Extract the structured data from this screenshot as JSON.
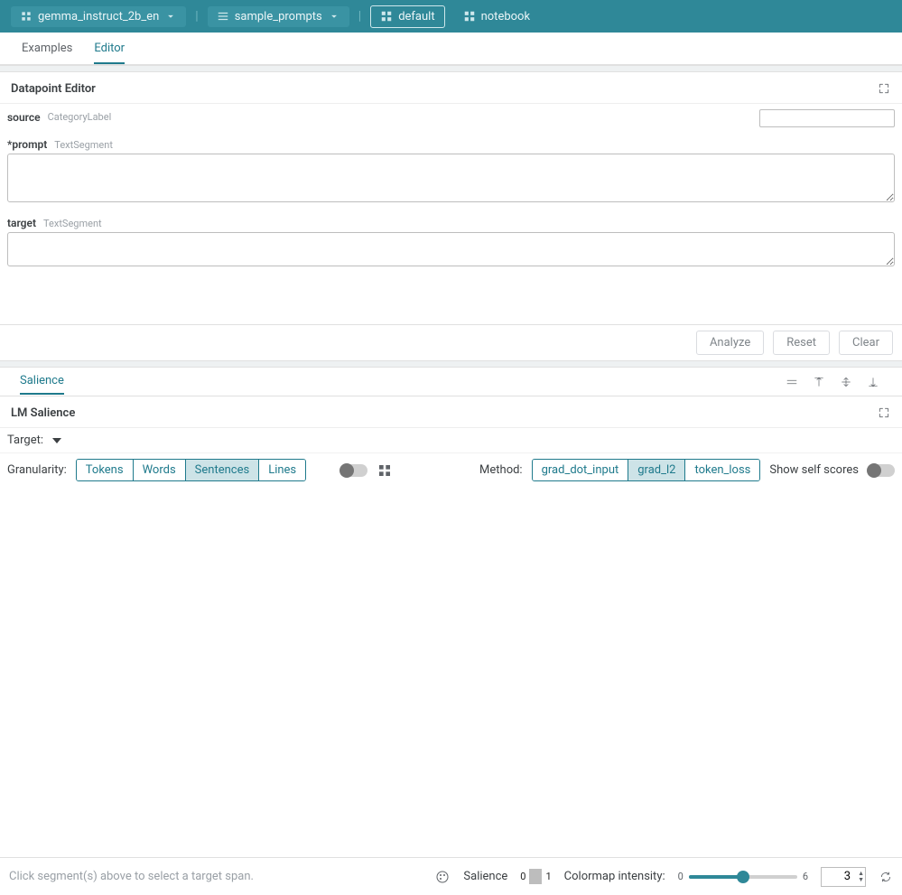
{
  "topbar": {
    "model": "gemma_instruct_2b_en",
    "dataset": "sample_prompts",
    "layout_default": "default",
    "layout_notebook": "notebook"
  },
  "tabs": {
    "examples": "Examples",
    "editor": "Editor",
    "active": "editor"
  },
  "datapoint_editor": {
    "title": "Datapoint Editor",
    "fields": {
      "source": {
        "label": "source",
        "type": "CategoryLabel",
        "value": ""
      },
      "prompt": {
        "label": "*prompt",
        "type": "TextSegment",
        "value": ""
      },
      "target": {
        "label": "target",
        "type": "TextSegment",
        "value": ""
      }
    },
    "buttons": {
      "analyze": "Analyze",
      "reset": "Reset",
      "clear": "Clear"
    }
  },
  "salience_panel": {
    "tab": "Salience",
    "title": "LM Salience",
    "target_label": "Target:",
    "granularity_label": "Granularity:",
    "granularity_options": [
      "Tokens",
      "Words",
      "Sentences",
      "Lines"
    ],
    "granularity_active": "Sentences",
    "method_label": "Method:",
    "method_options": [
      "grad_dot_input",
      "grad_l2",
      "token_loss"
    ],
    "method_active": "grad_l2",
    "self_scores_label": "Show self scores"
  },
  "footer": {
    "hint": "Click segment(s) above to select a target span.",
    "salience_label": "Salience",
    "scale_min": "0",
    "scale_max": "1",
    "colormap_label": "Colormap intensity:",
    "colormap_min": "0",
    "colormap_max": "6",
    "colormap_value": "3",
    "swatches": [
      "#ffffff",
      "#d5e4e7",
      "#a6cdd4",
      "#6aa9b4",
      "#3d8797",
      "#1e6b7d",
      "#135466"
    ]
  }
}
